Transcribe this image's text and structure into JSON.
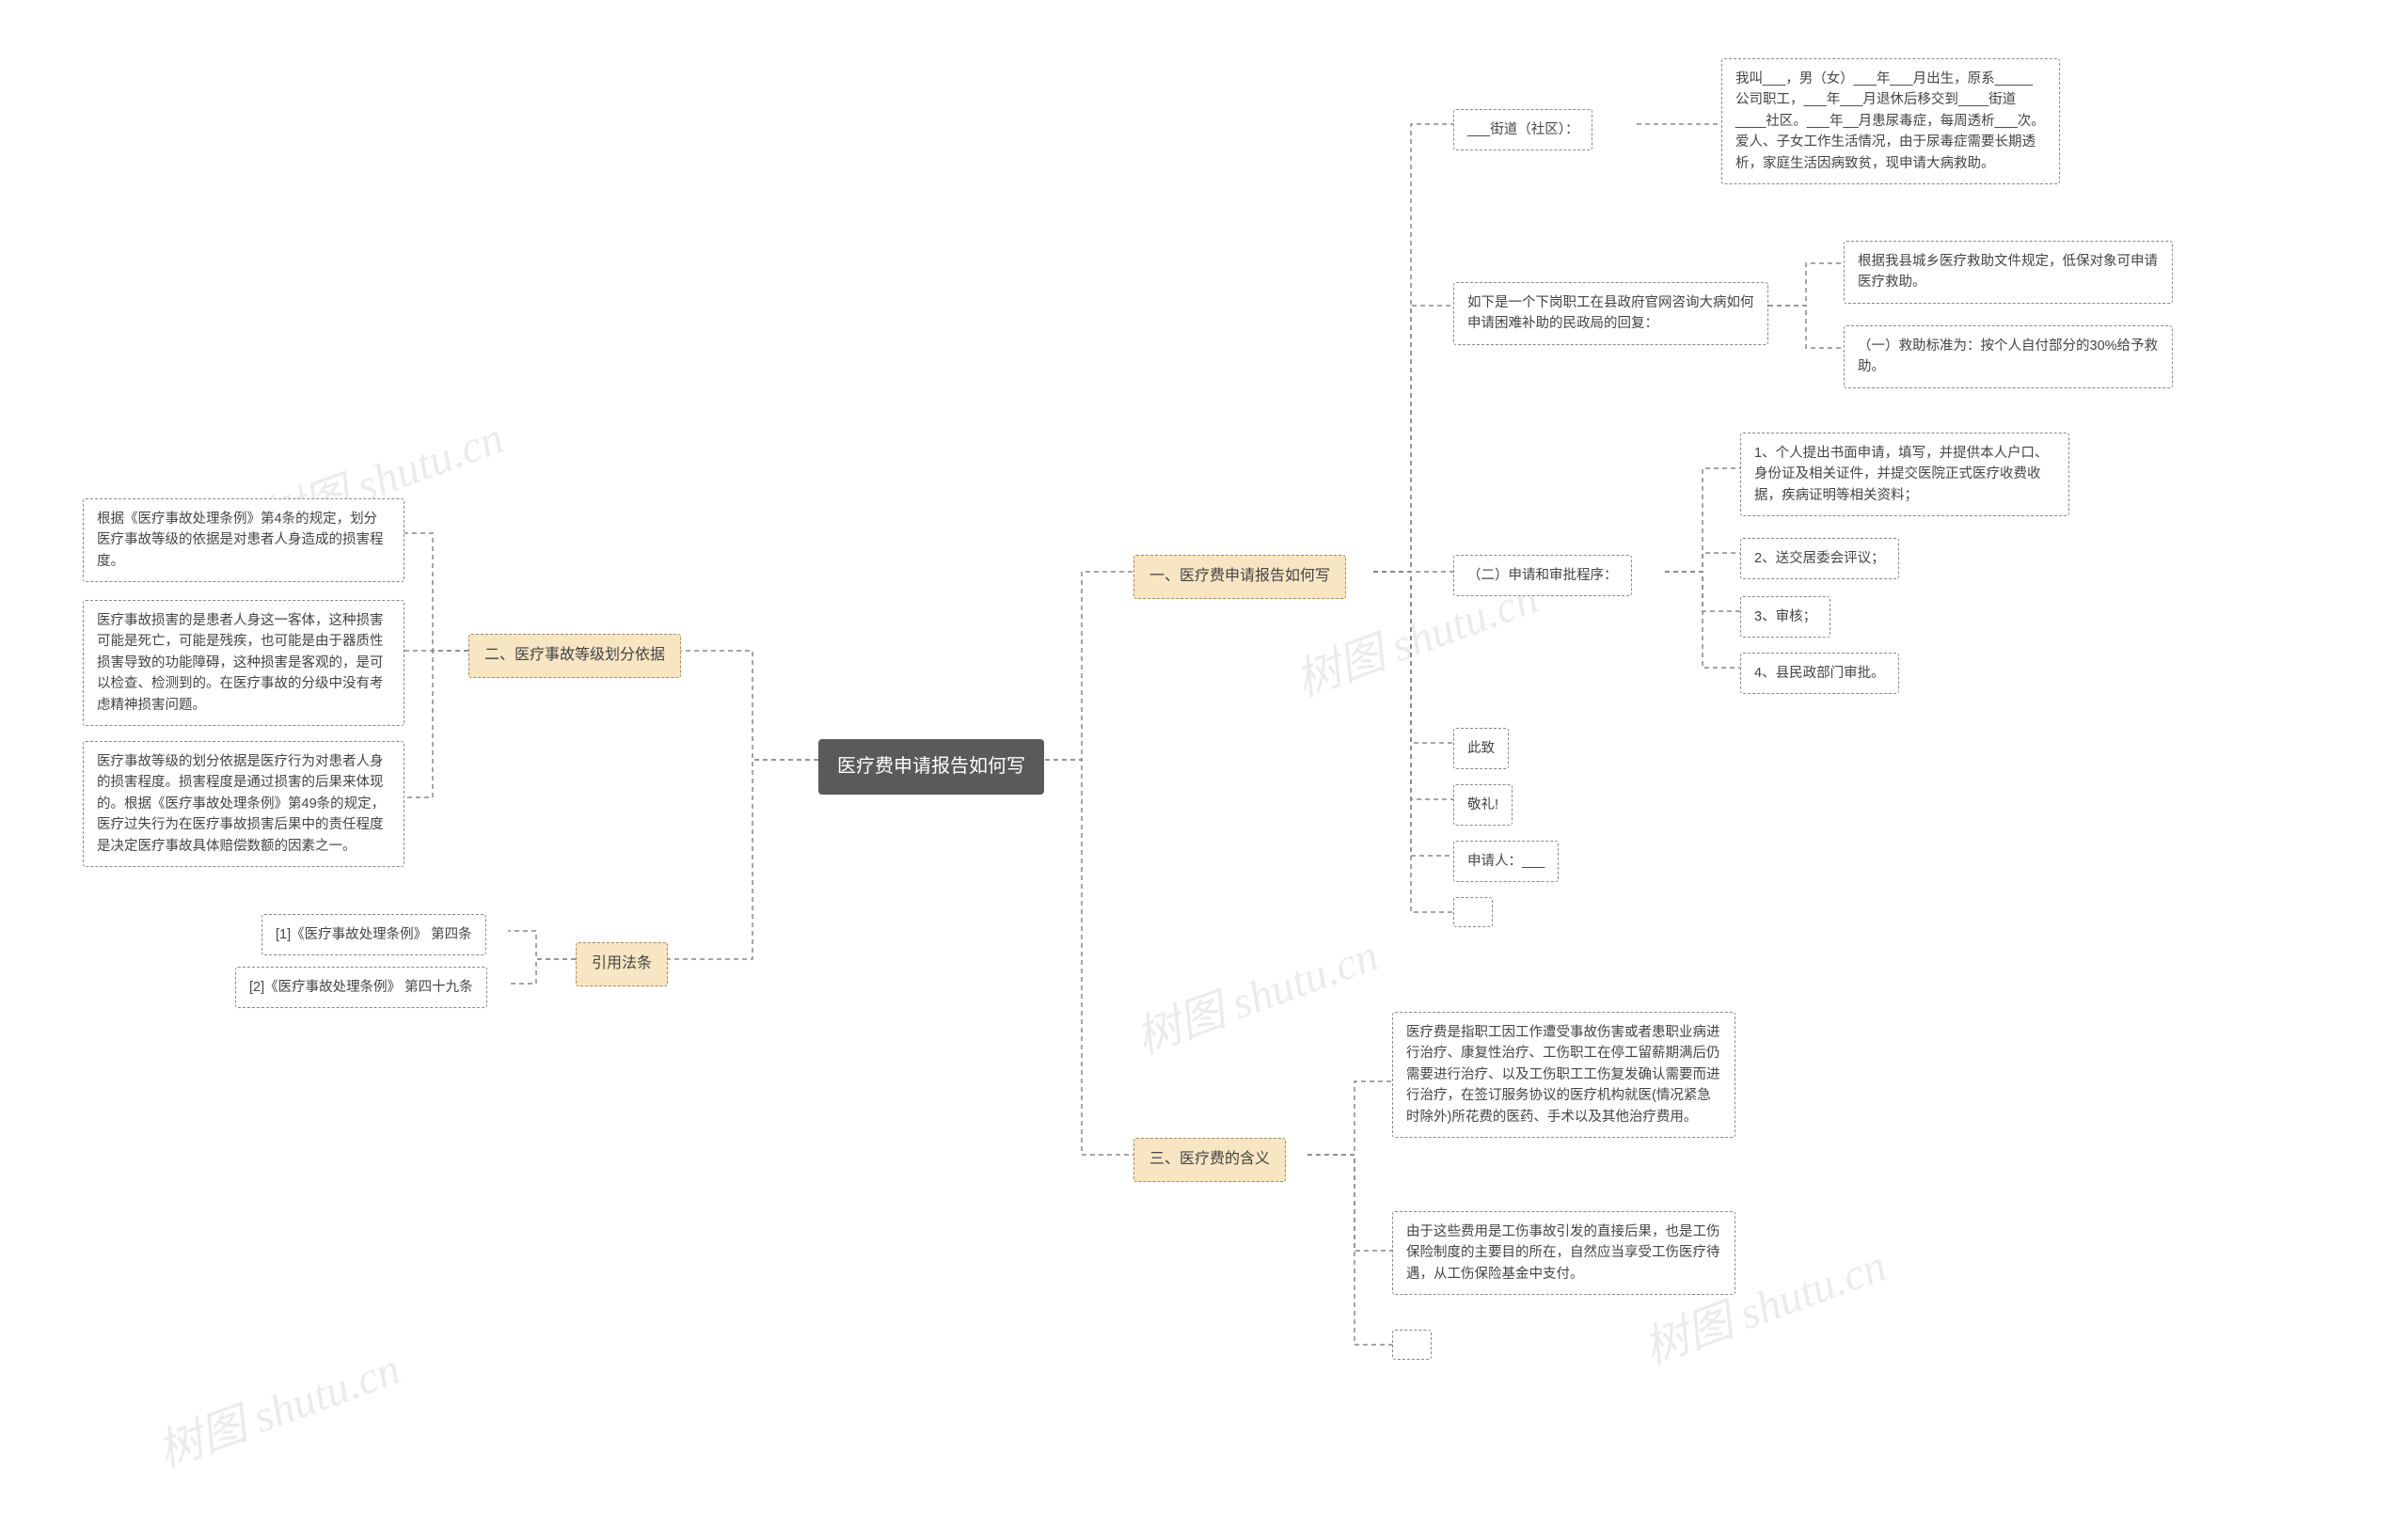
{
  "watermark_text": "树图 shutu.cn",
  "root": {
    "label": "医疗费申请报告如何写"
  },
  "right": {
    "section1": {
      "title": "一、医疗费申请报告如何写",
      "child1_label": "___街道（社区）：",
      "child1_detail": "我叫___，男（女）___年___月出生，原系_____公司职工，___年___月退休后移交到____街道____社区。___年__月患尿毒症，每周透析___次。爱人、子女工作生活情况，由于尿毒症需要长期透析，家庭生活因病致贫，现申请大病救助。",
      "child2_label": "如下是一个下岗职工在县政府官网咨询大病如何申请困难补助的民政局的回复：",
      "child2_detail_a": "根据我县城乡医疗救助文件规定，低保对象可申请医疗救助。",
      "child2_detail_b": "（一）救助标准为：按个人自付部分的30%给予救助。",
      "child3_label": "（二）申请和审批程序：",
      "child3_items": {
        "a": "1、个人提出书面申请，填写，并提供本人户口、身份证及相关证件，并提交医院正式医疗收费收据，疾病证明等相关资料；",
        "b": "2、送交居委会评议；",
        "c": "3、审核；",
        "d": "4、县民政部门审批。"
      },
      "closing": {
        "a": "此致",
        "b": "敬礼!",
        "c": "申请人：___"
      }
    },
    "section3": {
      "title": "三、医疗费的含义",
      "detail_a": "医疗费是指职工因工作遭受事故伤害或者患职业病进行治疗、康复性治疗、工伤职工在停工留薪期满后仍需要进行治疗、以及工伤职工工伤复发确认需要而进行治疗，在签订服务协议的医疗机构就医(情况紧急时除外)所花费的医药、手术以及其他治疗费用。",
      "detail_b": "由于这些费用是工伤事故引发的直接后果，也是工伤保险制度的主要目的所在，自然应当享受工伤医疗待遇，从工伤保险基金中支付。"
    }
  },
  "left": {
    "section2": {
      "title": "二、医疗事故等级划分依据",
      "detail_a": "根据《医疗事故处理条例》第4条的规定，划分医疗事故等级的依据是对患者人身造成的损害程度。",
      "detail_b": "医疗事故损害的是患者人身这一客体，这种损害可能是死亡，可能是残疾，也可能是由于器质性损害导致的功能障碍，这种损害是客观的，是可以检查、检测到的。在医疗事故的分级中没有考虑精神损害问题。",
      "detail_c": "医疗事故等级的划分依据是医疗行为对患者人身的损害程度。损害程度是通过损害的后果来体现的。根据《医疗事故处理条例》第49条的规定，医疗过失行为在医疗事故损害后果中的责任程度是决定医疗事故具体赔偿数额的因素之一。"
    },
    "law": {
      "title": "引用法条",
      "item_a": "[1]《医疗事故处理条例》 第四条",
      "item_b": "[2]《医疗事故处理条例》 第四十九条"
    }
  }
}
